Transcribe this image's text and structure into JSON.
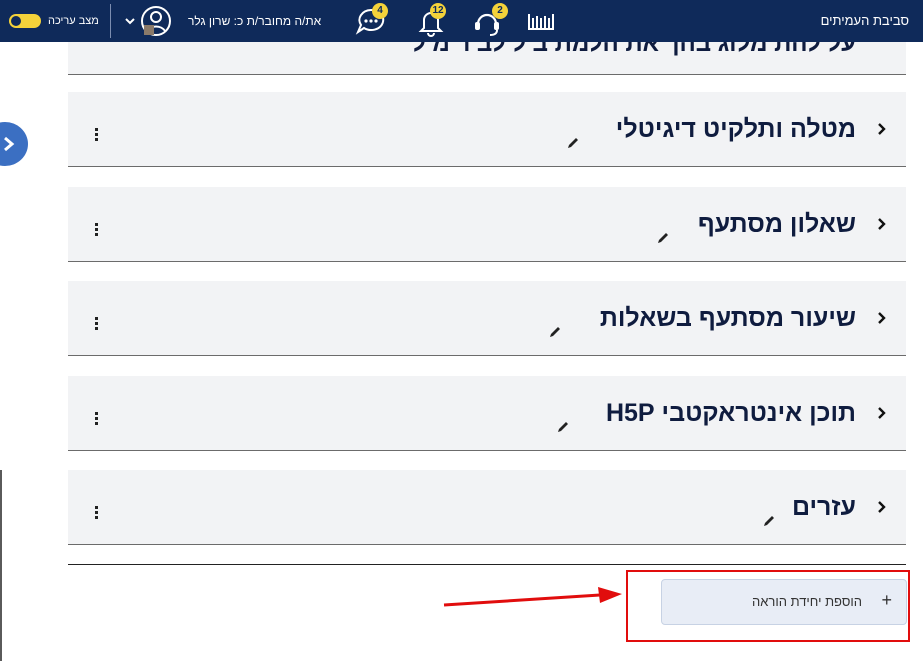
{
  "navbar": {
    "brand": "סביבת העמיתים",
    "user_text": "את/ה מחובר/ת כ: שרון גלר",
    "edit_mode_label": "מצב עריכה",
    "badges": {
      "messages": "4",
      "notifications": "12",
      "support": "2"
    },
    "colors": {
      "bg": "#0f2a5a",
      "badge": "#f4d23a"
    }
  },
  "partial_section": {
    "title": "על להת מלוג בהך את הלמת ב ל לב ר מ ל"
  },
  "sections": [
    {
      "title": "מטלה ותלקיט דיגיטלי"
    },
    {
      "title": "שאלון מסתעף"
    },
    {
      "title": "שיעור מסתעף בשאלות"
    },
    {
      "title": "תוכן אינטראקטבי H5P"
    },
    {
      "title": "עזרים"
    }
  ],
  "add_activity": {
    "label": "הוספת יחידת הוראה"
  },
  "colors": {
    "highlight": "#e10d0d",
    "section_bg": "#f2f3f5"
  }
}
